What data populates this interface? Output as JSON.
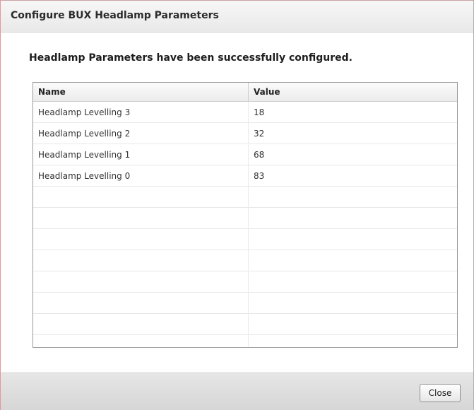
{
  "dialog": {
    "title": "Configure BUX Headlamp Parameters",
    "message": "Headlamp Parameters have been successfully configured."
  },
  "table": {
    "columns": {
      "name": "Name",
      "value": "Value"
    },
    "rows": [
      {
        "name": "Headlamp Levelling 3",
        "value": "18"
      },
      {
        "name": "Headlamp Levelling 2",
        "value": "32"
      },
      {
        "name": "Headlamp Levelling 1",
        "value": "68"
      },
      {
        "name": "Headlamp Levelling 0",
        "value": "83"
      },
      {
        "name": "",
        "value": ""
      },
      {
        "name": "",
        "value": ""
      },
      {
        "name": "",
        "value": ""
      },
      {
        "name": "",
        "value": ""
      },
      {
        "name": "",
        "value": ""
      },
      {
        "name": "",
        "value": ""
      },
      {
        "name": "",
        "value": ""
      },
      {
        "name": "",
        "value": ""
      }
    ]
  },
  "footer": {
    "close_label": "Close"
  }
}
